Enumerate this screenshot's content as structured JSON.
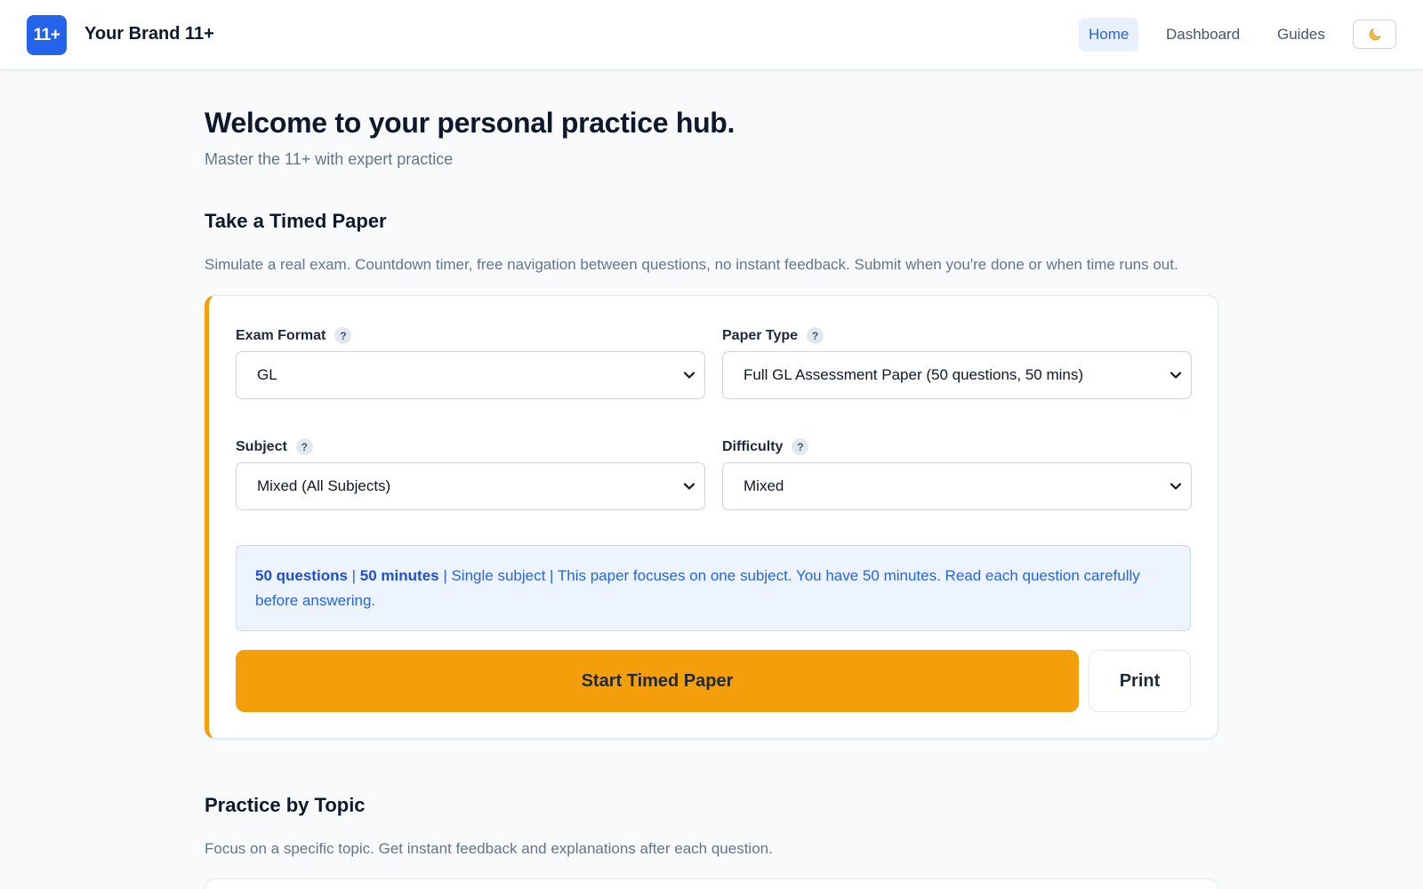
{
  "header": {
    "logo_text": "11+",
    "brand": "Your Brand 11+",
    "nav": [
      {
        "label": "Home",
        "active": true
      },
      {
        "label": "Dashboard",
        "active": false
      },
      {
        "label": "Guides",
        "active": false
      }
    ],
    "theme_icon": "moon-icon"
  },
  "hero": {
    "title": "Welcome to your personal practice hub.",
    "subtitle": "Master the 11+ with expert practice"
  },
  "timed": {
    "heading": "Take a Timed Paper",
    "description": "Simulate a real exam. Countdown timer, free navigation between questions, no instant feedback. Submit when you're done or when time runs out.",
    "fields": {
      "exam_format": {
        "label": "Exam Format",
        "value": "GL"
      },
      "paper_type": {
        "label": "Paper Type",
        "value": "Full GL Assessment Paper (50 questions, 50 mins)"
      },
      "subject": {
        "label": "Subject",
        "value": "Mixed (All Subjects)"
      },
      "difficulty": {
        "label": "Difficulty",
        "value": "Mixed"
      }
    },
    "help_glyph": "?",
    "info": {
      "questions": "50 questions",
      "sep1": " | ",
      "minutes": "50 minutes",
      "rest": " | Single subject | This paper focuses on one subject. You have 50 minutes. Read each question carefully before answering."
    },
    "start_label": "Start Timed Paper",
    "print_label": "Print"
  },
  "topic": {
    "heading": "Practice by Topic",
    "description": "Focus on a specific topic. Get instant feedback and explanations after each question."
  },
  "colors": {
    "primary": "#2563eb",
    "accent": "#f59e0b",
    "background": "#f8fafc"
  }
}
